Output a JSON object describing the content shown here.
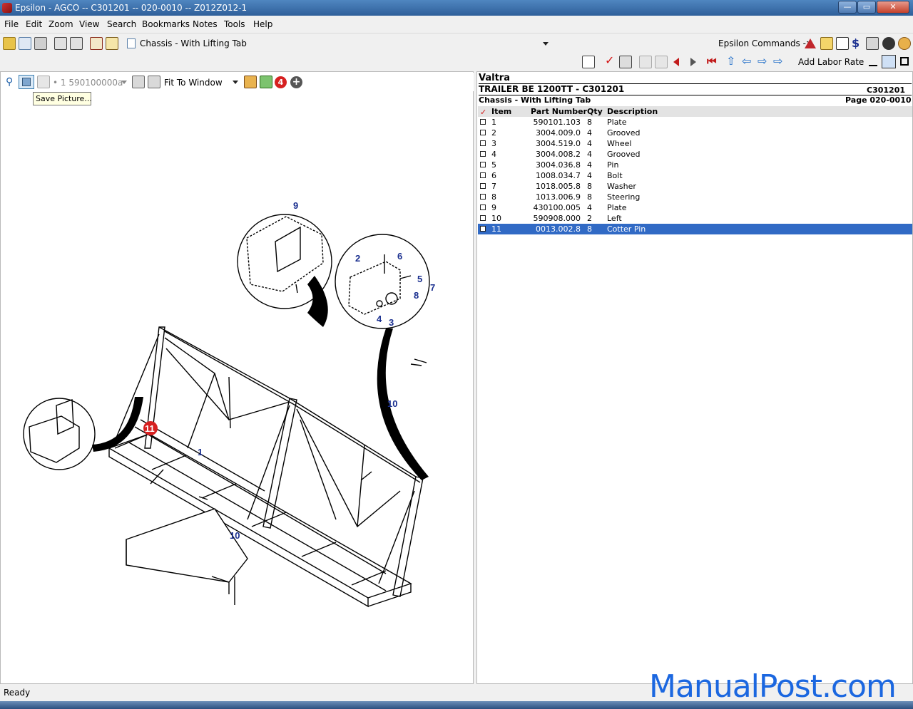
{
  "window": {
    "title": "Epsilon - AGCO -- C301201 -- 020-0010 -- Z012Z012-1",
    "controls": {
      "minimize": "—",
      "maximize": "▭",
      "close": "✕"
    }
  },
  "menu": [
    "File",
    "Edit",
    "Zoom",
    "View",
    "Search",
    "Bookmarks",
    "Notes",
    "Tools",
    "Help"
  ],
  "toolbar1": {
    "document_combo": "Chassis - With Lifting Tab",
    "commands_label": "Epsilon Commands ->"
  },
  "toolbar2": {
    "add_labor_rate": "Add Labor Rate"
  },
  "image_toolbar": {
    "page_combo": "• 1 590100000a",
    "zoom_combo": "Fit To Window",
    "badge_count": "4",
    "tooltip": "Save Picture..."
  },
  "diagram": {
    "callouts": [
      "9",
      "2",
      "6",
      "5",
      "7",
      "8",
      "4",
      "3",
      "10",
      "11",
      "1",
      "10"
    ]
  },
  "parts_header": {
    "brand": "Valtra",
    "model": "TRAILER BE 1200TT - C301201",
    "code": "C301201",
    "section": "Chassis - With Lifting Tab",
    "page": "Page 020-0010"
  },
  "parts_columns": {
    "item": "Item",
    "part": "Part Number",
    "qty": "Qty",
    "desc": "Description"
  },
  "parts": [
    {
      "item": "1",
      "part": "590101.103",
      "qty": "8",
      "desc": "Plate"
    },
    {
      "item": "2",
      "part": "3004.009.0",
      "qty": "4",
      "desc": "Grooved"
    },
    {
      "item": "3",
      "part": "3004.519.0",
      "qty": "4",
      "desc": "Wheel"
    },
    {
      "item": "4",
      "part": "3004.008.2",
      "qty": "4",
      "desc": "Grooved"
    },
    {
      "item": "5",
      "part": "3004.036.8",
      "qty": "4",
      "desc": "Pin"
    },
    {
      "item": "6",
      "part": "1008.034.7",
      "qty": "4",
      "desc": "Bolt"
    },
    {
      "item": "7",
      "part": "1018.005.8",
      "qty": "8",
      "desc": "Washer"
    },
    {
      "item": "8",
      "part": "1013.006.9",
      "qty": "8",
      "desc": "Steering"
    },
    {
      "item": "9",
      "part": "430100.005",
      "qty": "4",
      "desc": "Plate"
    },
    {
      "item": "10",
      "part": "590908.000",
      "qty": "2",
      "desc": "Left"
    },
    {
      "item": "11",
      "part": "0013.002.8",
      "qty": "8",
      "desc": "Cotter Pin",
      "selected": true
    }
  ],
  "status": "Ready",
  "watermark": "ManualPost.com",
  "colors": {
    "selection": "#316ac5",
    "callout": "#1a2f8f",
    "badge": "#d62020",
    "watermark": "#1b67e0"
  }
}
